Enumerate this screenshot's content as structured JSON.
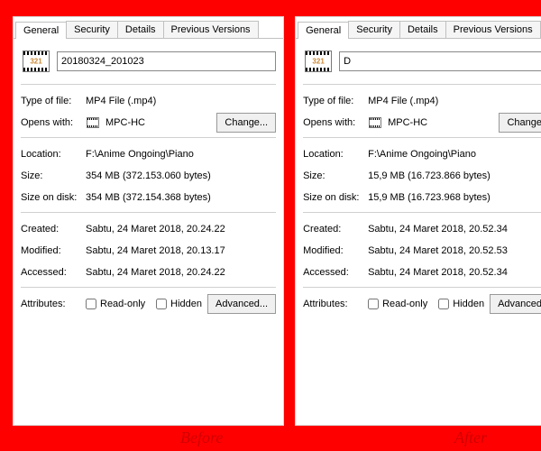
{
  "tabs": {
    "general": "General",
    "security": "Security",
    "details": "Details",
    "prev": "Previous Versions"
  },
  "labels": {
    "typeoffile": "Type of file:",
    "openswith": "Opens with:",
    "location": "Location:",
    "size": "Size:",
    "sizeondisk": "Size on disk:",
    "created": "Created:",
    "modified": "Modified:",
    "accessed": "Accessed:",
    "attributes": "Attributes:",
    "readonly": "Read-only",
    "hidden": "Hidden",
    "change": "Change...",
    "advanced": "Advanced...",
    "appname": "MPC-HC",
    "iconnum": "321"
  },
  "before": {
    "caption": "Before",
    "filename": "20180324_201023",
    "typeoffile": "MP4 File (.mp4)",
    "location": "F:\\Anime Ongoing\\Piano",
    "size": "354 MB (372.153.060 bytes)",
    "sizeondisk": "354 MB (372.154.368 bytes)",
    "created": "Sabtu, 24 Maret 2018, 20.24.22",
    "modified": "Sabtu, 24 Maret 2018, 20.13.17",
    "accessed": "Sabtu, 24 Maret 2018, 20.24.22"
  },
  "after": {
    "caption": "After",
    "filename": "D",
    "typeoffile": "MP4 File (.mp4)",
    "location": "F:\\Anime Ongoing\\Piano",
    "size": "15,9 MB (16.723.866 bytes)",
    "sizeondisk": "15,9 MB (16.723.968 bytes)",
    "created": "Sabtu, 24 Maret 2018, 20.52.34",
    "modified": "Sabtu, 24 Maret 2018, 20.52.53",
    "accessed": "Sabtu, 24 Maret 2018, 20.52.34"
  }
}
